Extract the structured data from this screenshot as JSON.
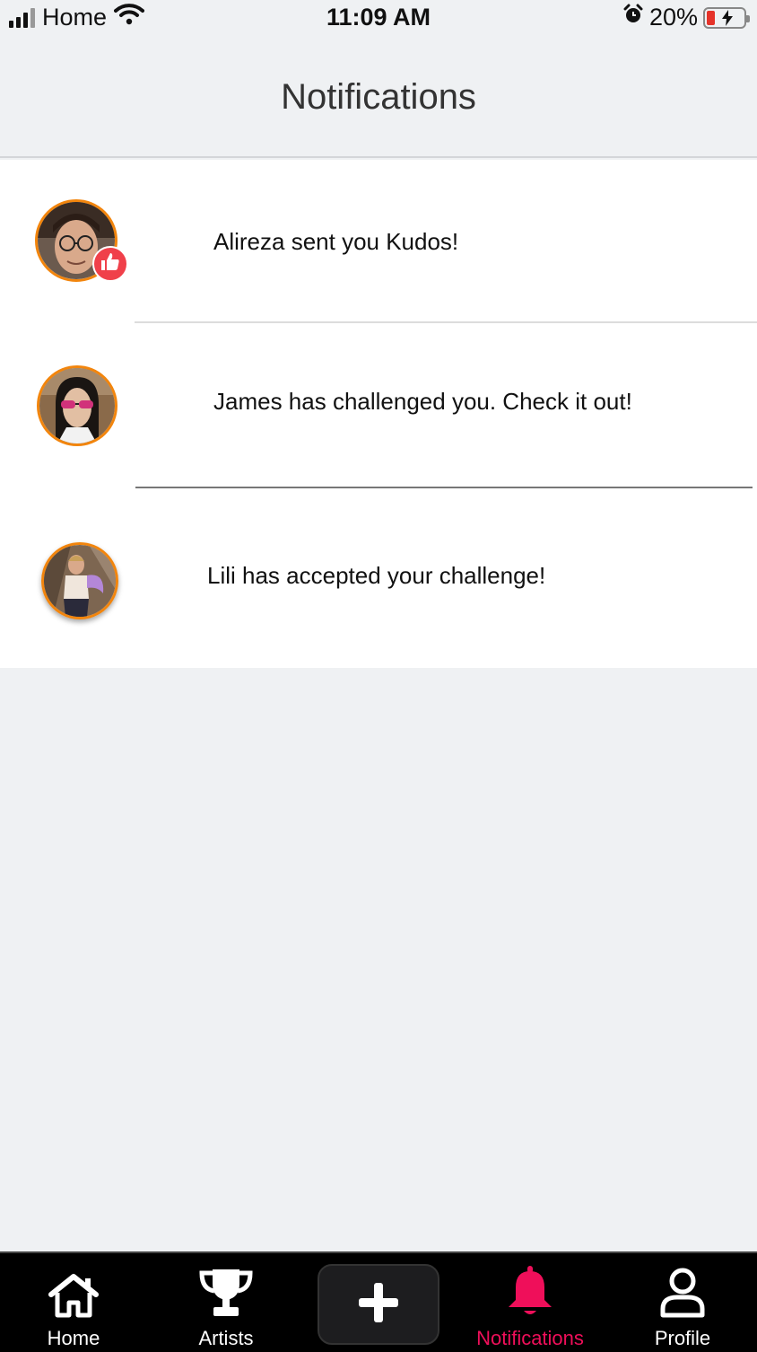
{
  "status_bar": {
    "carrier": "Home",
    "time": "11:09 AM",
    "battery_percent": "20%",
    "icons": [
      "signal-icon",
      "wifi-icon",
      "alarm-icon",
      "battery-icon"
    ]
  },
  "header": {
    "title": "Notifications"
  },
  "notifications": [
    {
      "message": "Alireza sent you Kudos!",
      "avatar": "avatar-alireza",
      "badge": "thumbs-up-icon"
    },
    {
      "message": "James has challenged you. Check it out!",
      "avatar": "avatar-james"
    },
    {
      "message": "Lili has accepted your challenge!",
      "avatar": "avatar-lili"
    }
  ],
  "tab_bar": {
    "home": {
      "label": "Home",
      "icon": "home-icon"
    },
    "artists": {
      "label": "Artists",
      "icon": "trophy-icon"
    },
    "add": {
      "icon": "plus-icon"
    },
    "notifications": {
      "label": "Notifications",
      "icon": "bell-icon",
      "active": true
    },
    "profile": {
      "label": "Profile",
      "icon": "person-icon"
    }
  },
  "colors": {
    "accent": "#ef0f5a",
    "avatar_ring": "#f2850d",
    "badge": "#f0404a",
    "background": "#eff1f3"
  }
}
